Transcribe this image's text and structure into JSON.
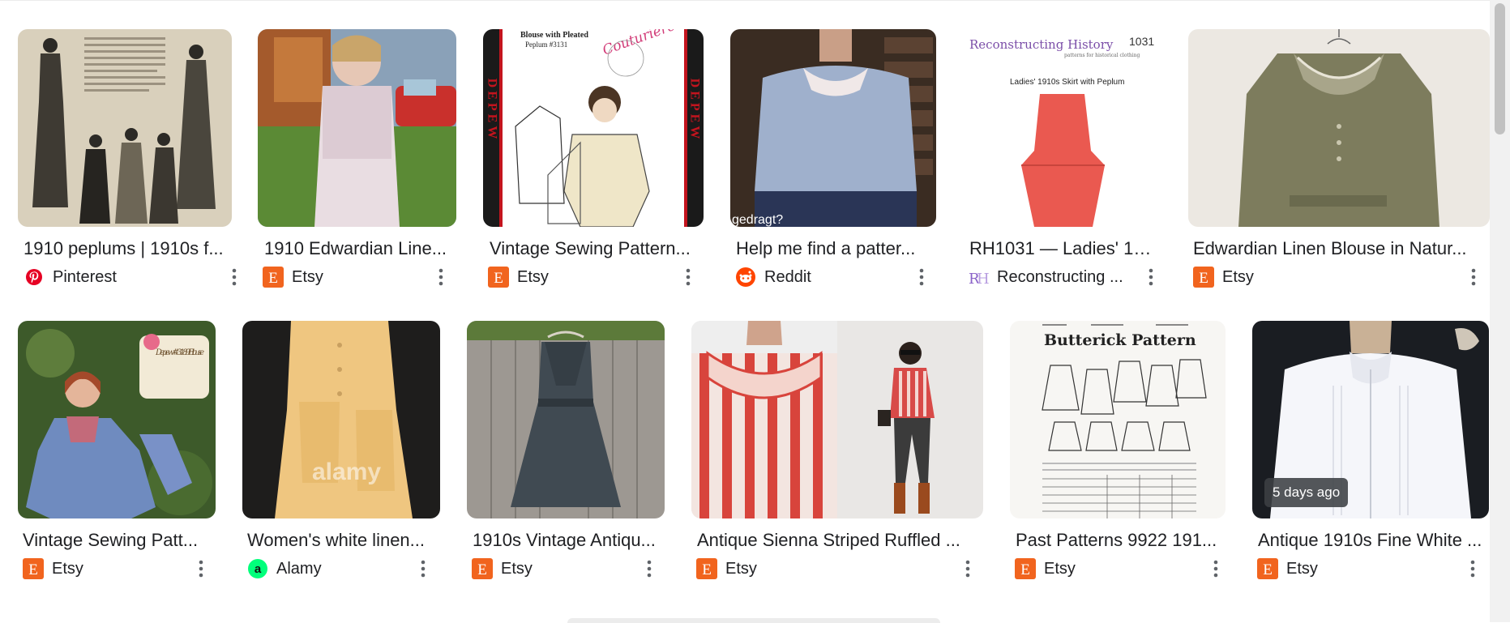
{
  "colors": {
    "etsy": "#f1641e",
    "pinterest": "#e60023",
    "reddit": "#ff4500",
    "alamy": "#00ff7b",
    "reconstructing": "#8a62c8"
  },
  "results": [
    {
      "title": "1910 peplums | 1910s f...",
      "source": "Pinterest",
      "favicon": "pinterest-icon"
    },
    {
      "title": "1910 Edwardian Line...",
      "source": "Etsy",
      "favicon": "etsy-icon"
    },
    {
      "title": "Vintage Sewing Pattern...",
      "source": "Etsy",
      "favicon": "etsy-icon",
      "image_text": {
        "heading": "Blouse with Pleated",
        "subheading": "Peplum #3131",
        "script": "Couturière",
        "sidebar": "DEPEW"
      }
    },
    {
      "title": "Help me find a patter...",
      "source": "Reddit",
      "favicon": "reddit-icon",
      "image_text": {
        "caption": "gedragt?"
      }
    },
    {
      "title": "RH1031 — Ladies' 191...",
      "source": "Reconstructing ...",
      "favicon": "reconstructing-history-icon",
      "image_text": {
        "brand": "Reconstructing History",
        "number": "1031",
        "tagline": "patterns for historical clothing",
        "caption": "Ladies' 1910s Skirt with Peplum"
      }
    },
    {
      "title": "Edwardian Linen Blouse in Natur...",
      "source": "Etsy",
      "favicon": "etsy-icon"
    },
    {
      "title": "Vintage Sewing Patt...",
      "source": "Etsy",
      "favicon": "etsy-icon",
      "image_text": {
        "label": "Depew #3189 Blouse"
      }
    },
    {
      "title": "Women's white linen...",
      "source": "Alamy",
      "favicon": "alamy-icon",
      "image_text": {
        "watermark": "alamy"
      }
    },
    {
      "title": "1910s Vintage Antiqu...",
      "source": "Etsy",
      "favicon": "etsy-icon"
    },
    {
      "title": "Antique Sienna Striped Ruffled ...",
      "source": "Etsy",
      "favicon": "etsy-icon"
    },
    {
      "title": "Past Patterns 9922 191...",
      "source": "Etsy",
      "favicon": "etsy-icon",
      "image_text": {
        "heading": "Butterick Pattern"
      }
    },
    {
      "title": "Antique 1910s Fine White ...",
      "source": "Etsy",
      "favicon": "etsy-icon",
      "badge": "5 days ago"
    }
  ]
}
